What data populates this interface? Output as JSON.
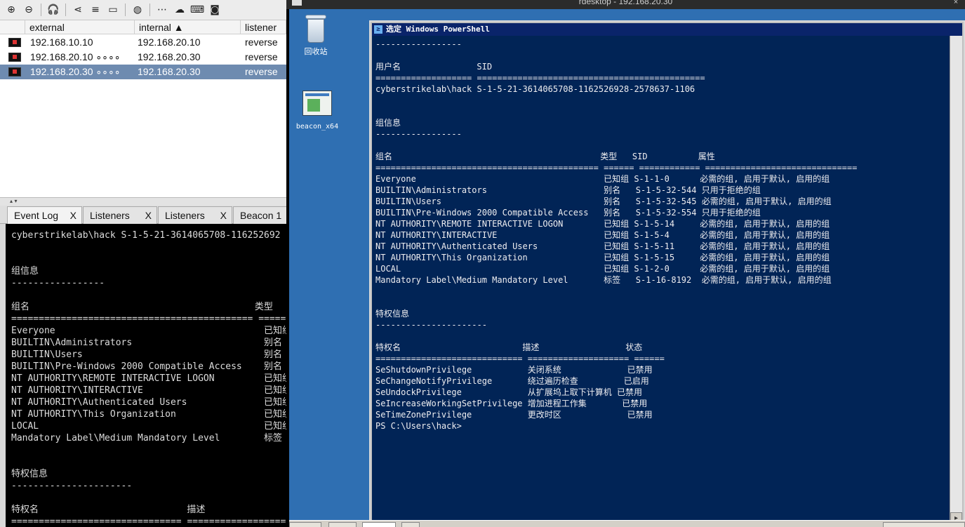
{
  "toolbar": {
    "icons": [
      "plus-circle-icon",
      "minus-circle-icon",
      "headphones-icon",
      "share-icon",
      "list-icon",
      "monitor-icon",
      "globe-icon",
      "ellipsis-icon",
      "cloud-download-icon",
      "keyboard-icon",
      "camera-icon"
    ],
    "glyphs": [
      "⊕",
      "⊖",
      "🎧",
      "⋖",
      "≡",
      "▭",
      "◍",
      "⋯",
      "☁",
      "⌨",
      "◙"
    ]
  },
  "sessions": {
    "columns": [
      "external",
      "internal ▲",
      "listener"
    ],
    "rows": [
      {
        "external": "192.168.10.10",
        "internal": "192.168.20.10",
        "listener": "reverse",
        "selected": false
      },
      {
        "external": "192.168.20.10 ∘∘∘∘",
        "internal": "192.168.20.30",
        "listener": "reverse",
        "selected": false
      },
      {
        "external": "192.168.20.30 ∘∘∘∘",
        "internal": "192.168.20.30",
        "listener": "reverse",
        "selected": true
      }
    ]
  },
  "divider": {
    "arrows": "▴ ▾"
  },
  "tabs": [
    {
      "label": "Event Log",
      "close": "X"
    },
    {
      "label": "Listeners",
      "close": "X"
    },
    {
      "label": "Listeners",
      "close": "X"
    },
    {
      "label": "Beacon 1",
      "close": ""
    }
  ],
  "console_lines": [
    "cyberstrikelab\\hack S-1-5-21-3614065708-116252692",
    "",
    "",
    "组信息",
    "-----------------",
    "",
    "组名                                         类型",
    "============================================ =====",
    "Everyone                                      已知组",
    "BUILTIN\\Administrators                        别名",
    "BUILTIN\\Users                                 别名",
    "BUILTIN\\Pre-Windows 2000 Compatible Access    别名",
    "NT AUTHORITY\\REMOTE INTERACTIVE LOGON         已知组",
    "NT AUTHORITY\\INTERACTIVE                      已知组",
    "NT AUTHORITY\\Authenticated Users              已知组",
    "NT AUTHORITY\\This Organization                已知组",
    "LOCAL                                         已知组",
    "Mandatory Label\\Medium Mandatory Level        标签",
    "",
    "",
    "特权信息",
    "----------------------",
    "",
    "特权名                           描述",
    "=============================== ==================="
  ],
  "rdp": {
    "title": "rdesktop - 192.168.20.30",
    "close": "×"
  },
  "desktop": {
    "icons": [
      {
        "label": "回收站"
      },
      {
        "label": "beacon_x64"
      }
    ]
  },
  "powershell": {
    "title": "选定 Windows PowerShell",
    "title_icon": "≥",
    "lines": [
      "-----------------",
      "",
      "用户名               SID",
      "=================== =============================================",
      "cyberstrikelab\\hack S-1-5-21-3614065708-1162526928-2578637-1106",
      "",
      "",
      "组信息",
      "-----------------",
      "",
      "组名                                         类型   SID          属性",
      "============================================ ====== ============ ==============================",
      "Everyone                                     已知组 S-1-1-0      必需的组, 启用于默认, 启用的组",
      "BUILTIN\\Administrators                       别名   S-1-5-32-544 只用于拒绝的组",
      "BUILTIN\\Users                                别名   S-1-5-32-545 必需的组, 启用于默认, 启用的组",
      "BUILTIN\\Pre-Windows 2000 Compatible Access   别名   S-1-5-32-554 只用于拒绝的组",
      "NT AUTHORITY\\REMOTE INTERACTIVE LOGON        已知组 S-1-5-14     必需的组, 启用于默认, 启用的组",
      "NT AUTHORITY\\INTERACTIVE                     已知组 S-1-5-4      必需的组, 启用于默认, 启用的组",
      "NT AUTHORITY\\Authenticated Users             已知组 S-1-5-11     必需的组, 启用于默认, 启用的组",
      "NT AUTHORITY\\This Organization               已知组 S-1-5-15     必需的组, 启用于默认, 启用的组",
      "LOCAL                                        已知组 S-1-2-0      必需的组, 启用于默认, 启用的组",
      "Mandatory Label\\Medium Mandatory Level       标签   S-1-16-8192  必需的组, 启用于默认, 启用的组",
      "",
      "",
      "特权信息",
      "----------------------",
      "",
      "特权名                        描述                 状态",
      "============================= ==================== ======",
      "SeShutdownPrivilege           关闭系统             已禁用",
      "SeChangeNotifyPrivilege       绕过遍历检查         已启用",
      "SeUndockPrivilege             从扩展坞上取下计算机 已禁用",
      "SeIncreaseWorkingSetPrivilege 增加进程工作集       已禁用",
      "SeTimeZonePrivilege           更改时区             已禁用",
      "PS C:\\Users\\hack>"
    ]
  },
  "colors": {
    "ps_bg": "#012456",
    "ps_fg": "#eeedf0",
    "desktop_bg": "#2f6fb2",
    "selected_row": "#6e8bb0"
  }
}
